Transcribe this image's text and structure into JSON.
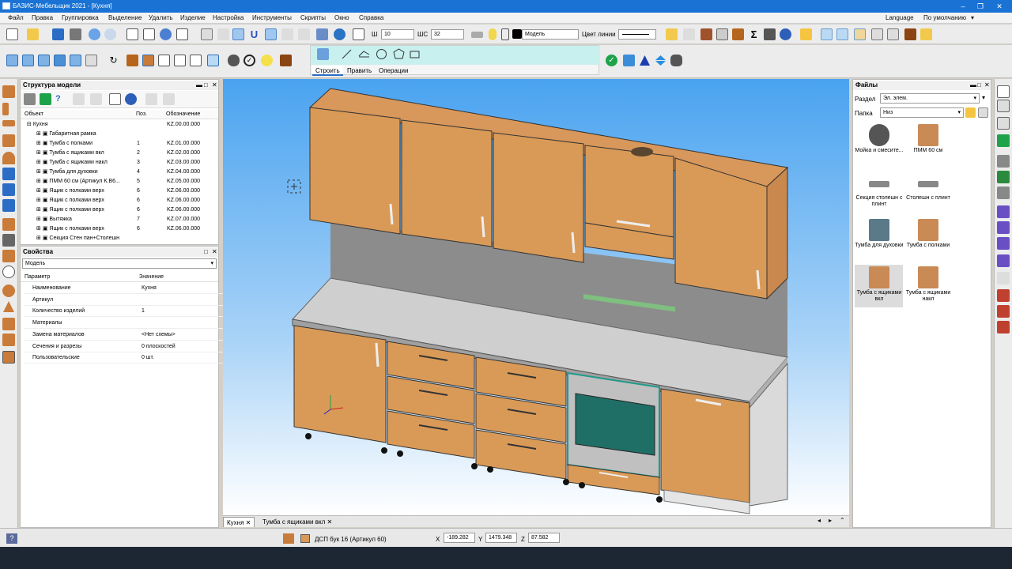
{
  "window": {
    "title": "БАЗИС-Мебельщик 2021 - [Кухня]"
  },
  "menu": [
    "Файл",
    "Правка",
    "Группировка",
    "Выделение",
    "Удалить",
    "Изделие",
    "Настройка",
    "Инструменты",
    "Скрипты",
    "Окно",
    "Справка"
  ],
  "menu_right": {
    "language": "Language",
    "preset": "По умолчанию"
  },
  "toolbar": {
    "w_label": "Ш",
    "w_value": "10",
    "shs_label": "ШС",
    "shs_value": "32",
    "model_value": "Модель",
    "line_color_label": "Цвет линии"
  },
  "draw_tabs": [
    "Строить",
    "Править",
    "Операции"
  ],
  "structure": {
    "title": "Структура модели",
    "col_object": "Объект",
    "col_pos": "Поз.",
    "col_code": "Обозначение",
    "root": {
      "name": "Кухня",
      "code": "KZ.00.00.000"
    },
    "items": [
      {
        "name": "Габаритная рамка",
        "pos": "",
        "code": ""
      },
      {
        "name": "Тумба с полками",
        "pos": "1",
        "code": "KZ.01.00.000"
      },
      {
        "name": "Тумба с ящиками вкл",
        "pos": "2",
        "code": "KZ.02.00.000"
      },
      {
        "name": "Тумба с ящиками накл",
        "pos": "3",
        "code": "KZ.03.00.000"
      },
      {
        "name": "Тумба для духовки",
        "pos": "4",
        "code": "KZ.04.00.000"
      },
      {
        "name": "ПММ 60 см (Артикул К.В6...",
        "pos": "5",
        "code": "KZ.05.00.000"
      },
      {
        "name": "Ящик с полками верх",
        "pos": "6",
        "code": "KZ.06.00.000"
      },
      {
        "name": "Ящик с полками верх",
        "pos": "6",
        "code": "KZ.06.00.000"
      },
      {
        "name": "Ящик с полками верх",
        "pos": "6",
        "code": "KZ.06.00.000"
      },
      {
        "name": "Вытяжка",
        "pos": "7",
        "code": "KZ.07.00.000"
      },
      {
        "name": "Ящик с полками верх",
        "pos": "6",
        "code": "KZ.06.00.000"
      },
      {
        "name": "Секция Стен пан+Столешн",
        "pos": "",
        "code": ""
      }
    ]
  },
  "properties": {
    "title": "Свойства",
    "selector": "Модель",
    "col_param": "Параметр",
    "col_value": "Значение",
    "rows": [
      {
        "k": "Наименование",
        "v": "Кухня"
      },
      {
        "k": "Артикул",
        "v": ""
      },
      {
        "k": "Количество изделий",
        "v": "1"
      },
      {
        "k": "Материалы",
        "v": ""
      },
      {
        "k": "Замена материалов",
        "v": "<Нет схемы>"
      },
      {
        "k": "Сечения и разрезы",
        "v": "0 плоскостей"
      },
      {
        "k": "Пользовательские",
        "v": "0 шт."
      }
    ]
  },
  "files": {
    "title": "Файлы",
    "section_label": "Раздел",
    "section_value": "Эл. элем.",
    "folder_label": "Папка",
    "folder_value": "Низ",
    "items": [
      {
        "label": "Мойка и смесите...",
        "icon": "sink-mixer-icon"
      },
      {
        "label": "ПММ 60 см",
        "icon": "dishwasher-icon"
      },
      {
        "label": "Секция столешн с плинт",
        "icon": "countertop-plinth-icon"
      },
      {
        "label": "Столешн с плинт",
        "icon": "countertop-icon"
      },
      {
        "label": "Тумба для духовки",
        "icon": "oven-cabinet-icon"
      },
      {
        "label": "Тумба с полками",
        "icon": "shelf-cabinet-icon"
      },
      {
        "label": "Тумба с ящиками вкл",
        "icon": "drawer-cabinet-inset-icon"
      },
      {
        "label": "Тумба с ящиками накл",
        "icon": "drawer-cabinet-overlay-icon"
      }
    ]
  },
  "tabs": [
    {
      "label": "Кухня"
    },
    {
      "label": "Тумба с ящиками вкл"
    }
  ],
  "status": {
    "material": "ДСП бук 16 (Артикул 60)",
    "x_label": "X",
    "x": "-189.282",
    "y_label": "Y",
    "y": "1479.348",
    "z_label": "Z",
    "z": "87.582"
  },
  "colors": {
    "titlebar": "#1a73d4",
    "viewport_top": "#4aa3f0",
    "viewport_bottom": "#ffffff",
    "wood": "#d99a58",
    "countertop": "#c8c8c8"
  }
}
